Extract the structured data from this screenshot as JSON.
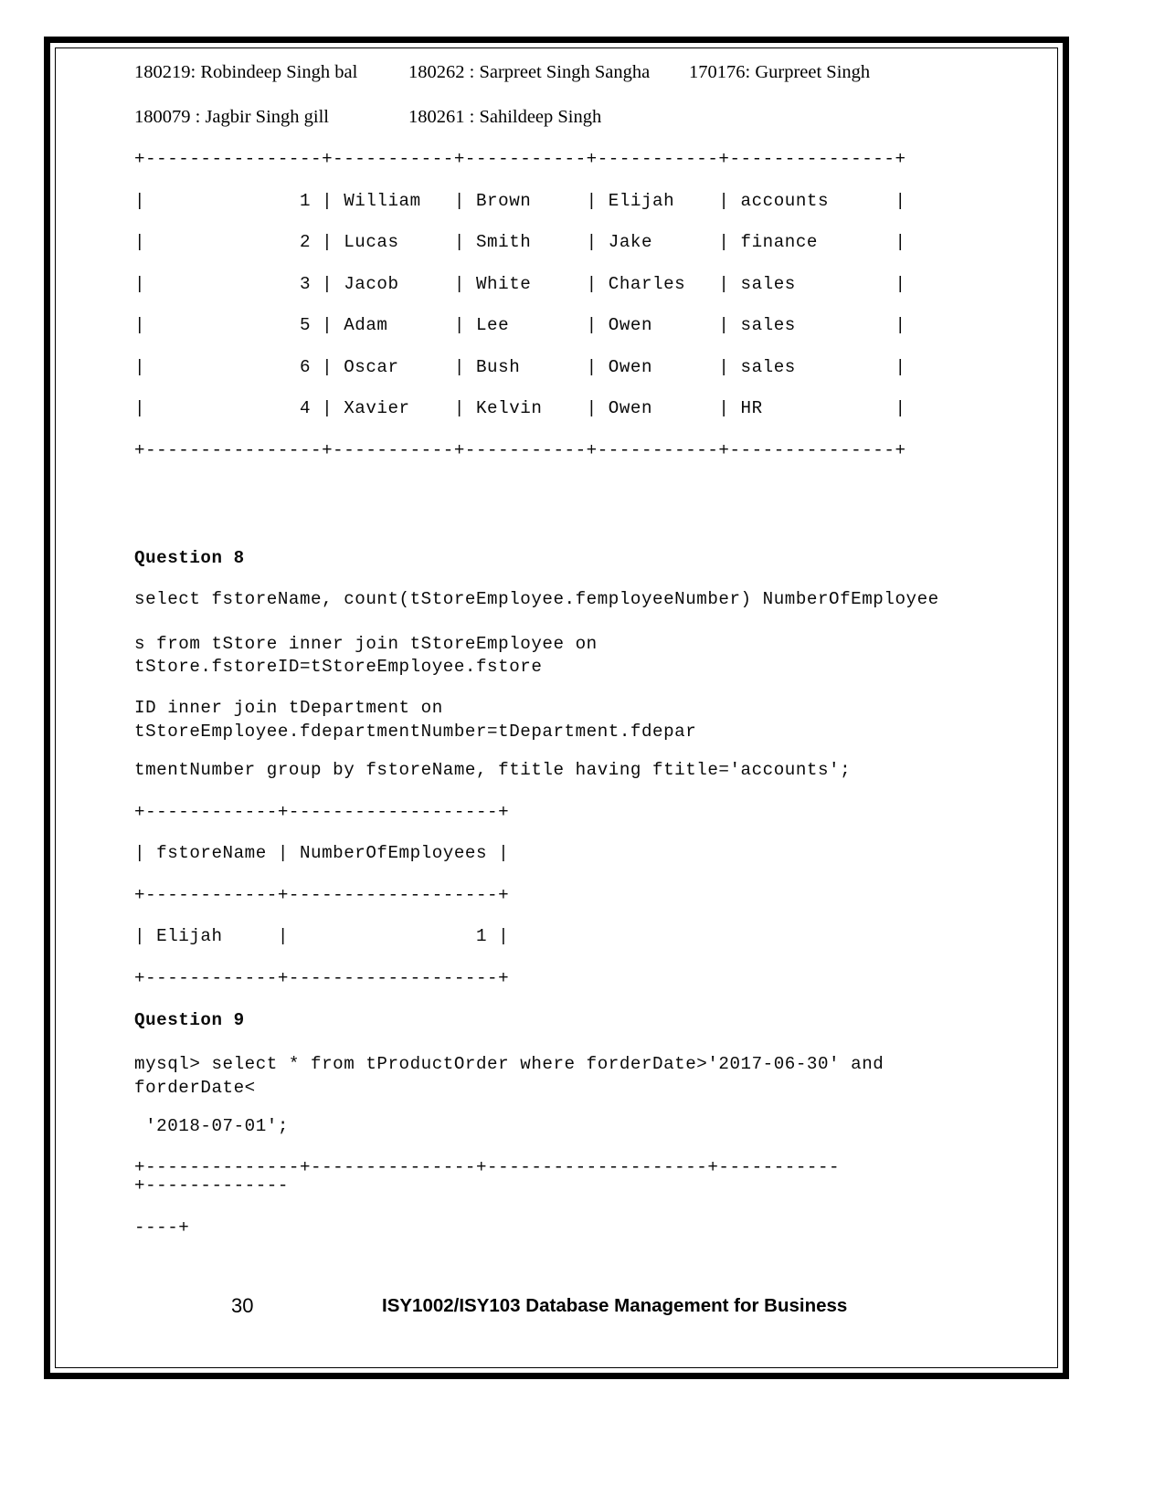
{
  "document": {
    "type": "assignment-answer-sheet",
    "page_number": "30",
    "footer_course": "ISY1002/ISY103 Database Management for Business"
  },
  "roster": {
    "row1": {
      "a": "180219: Robindeep Singh bal",
      "b": "180262 : Sarpreet Singh Sangha",
      "c": "170176: Gurpreet Singh"
    },
    "row2": {
      "a": "180079 : Jagbir Singh gill",
      "b": "180261 : Sahildeep Singh",
      "c": ""
    }
  },
  "employee_result": {
    "rule_top": "+----------------+-----------+-----------+-----------+---------------+",
    "rows": [
      "|              1 | William   | Brown     | Elijah    | accounts      |",
      "|              2 | Lucas     | Smith     | Jake      | finance       |",
      "|              3 | Jacob     | White     | Charles   | sales         |",
      "|              5 | Adam      | Lee       | Owen      | sales         |",
      "|              6 | Oscar     | Bush      | Owen      | sales         |",
      "|              4 | Xavier    | Kelvin    | Owen      | HR            |"
    ],
    "rule_bottom": "+----------------+-----------+-----------+-----------+---------------+"
  },
  "question8": {
    "heading": "Question 8",
    "sql_line1": "select fstoreName, count(tStoreEmployee.femployeeNumber) NumberOfEmployee",
    "sql_line2": "s from tStore inner join tStoreEmployee on\ntStore.fstoreID=tStoreEmployee.fstore",
    "sql_line3": "ID inner join tDepartment on\ntStoreEmployee.fdepartmentNumber=tDepartment.fdepar",
    "sql_line4": "tmentNumber group by fstoreName, ftitle having ftitle='accounts';",
    "result": {
      "rule_top": "+------------+-------------------+",
      "header": "| fstoreName | NumberOfEmployees |",
      "rule_mid": "+------------+-------------------+",
      "row1": "| Elijah     |                 1 |",
      "rule_bottom": "+------------+-------------------+"
    }
  },
  "question9": {
    "heading": "Question 9",
    "sql_line1": "mysql> select * from tProductOrder where forderDate>'2017-06-30' and\nforderDate<",
    "sql_line2": " '2018-07-01';",
    "rule_part1": "+--------------+---------------+--------------------+-----------",
    "rule_part2": "+-------------",
    "rule_part3": "----+"
  }
}
